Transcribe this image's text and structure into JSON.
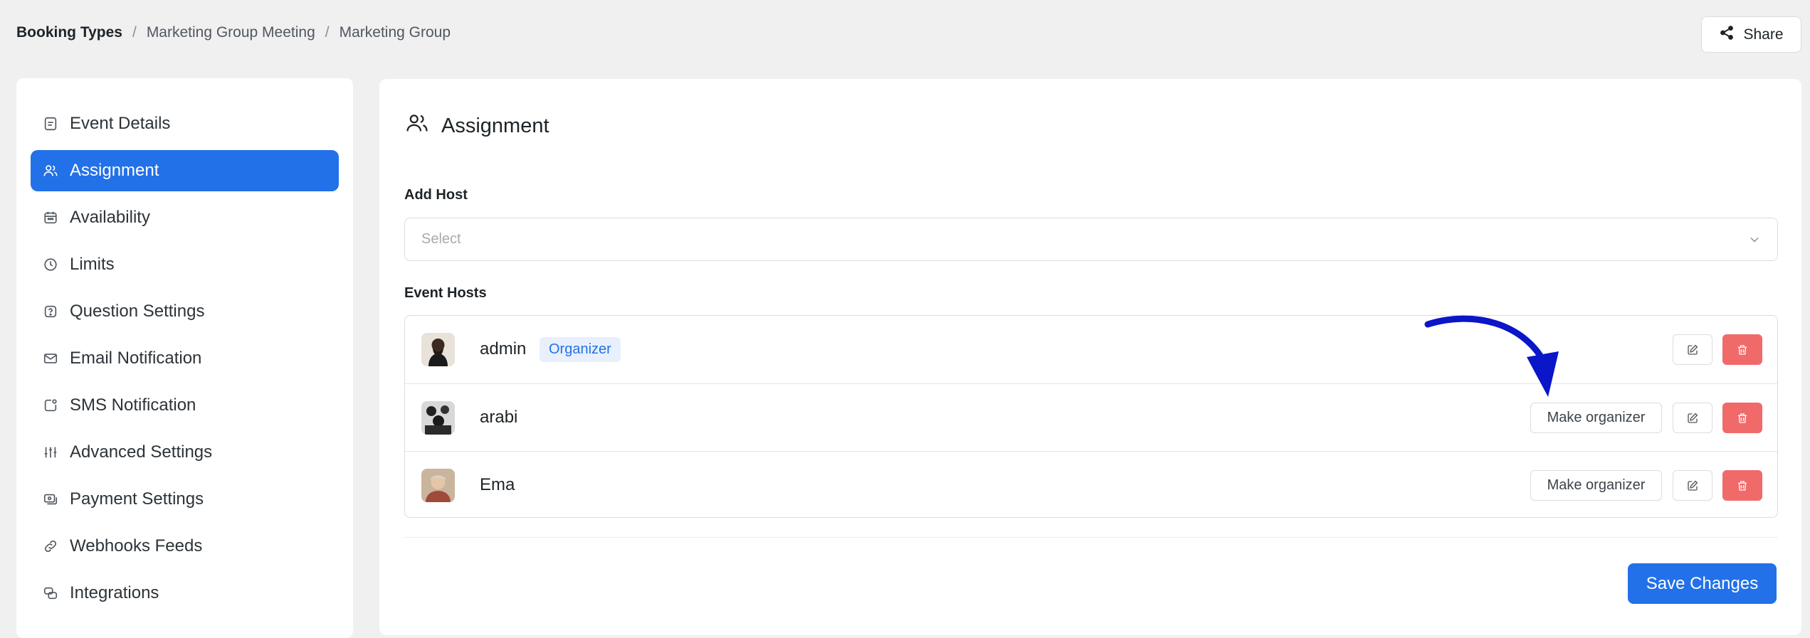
{
  "breadcrumb": {
    "root": "Booking Types",
    "items": [
      "Marketing Group Meeting",
      "Marketing Group"
    ]
  },
  "share": {
    "label": "Share"
  },
  "sidebar": {
    "items": [
      {
        "label": "Event Details",
        "icon": "document-icon"
      },
      {
        "label": "Assignment",
        "icon": "users-icon",
        "active": true
      },
      {
        "label": "Availability",
        "icon": "calendar-icon"
      },
      {
        "label": "Limits",
        "icon": "clock-icon"
      },
      {
        "label": "Question Settings",
        "icon": "question-icon"
      },
      {
        "label": "Email Notification",
        "icon": "mail-icon"
      },
      {
        "label": "SMS Notification",
        "icon": "sms-icon"
      },
      {
        "label": "Advanced Settings",
        "icon": "sliders-icon"
      },
      {
        "label": "Payment Settings",
        "icon": "payment-icon"
      },
      {
        "label": "Webhooks Feeds",
        "icon": "link-icon"
      },
      {
        "label": "Integrations",
        "icon": "integrations-icon"
      }
    ]
  },
  "main": {
    "title": "Assignment",
    "add_host_label": "Add Host",
    "select_placeholder": "Select",
    "event_hosts_label": "Event Hosts",
    "hosts": [
      {
        "name": "admin",
        "badge": "Organizer"
      },
      {
        "name": "arabi",
        "action": "Make organizer"
      },
      {
        "name": "Ema",
        "action": "Make organizer"
      }
    ],
    "save_label": "Save Changes"
  },
  "colors": {
    "accent": "#2271e8",
    "danger": "#f16a6a",
    "annotation_arrow": "#0a16c8"
  }
}
